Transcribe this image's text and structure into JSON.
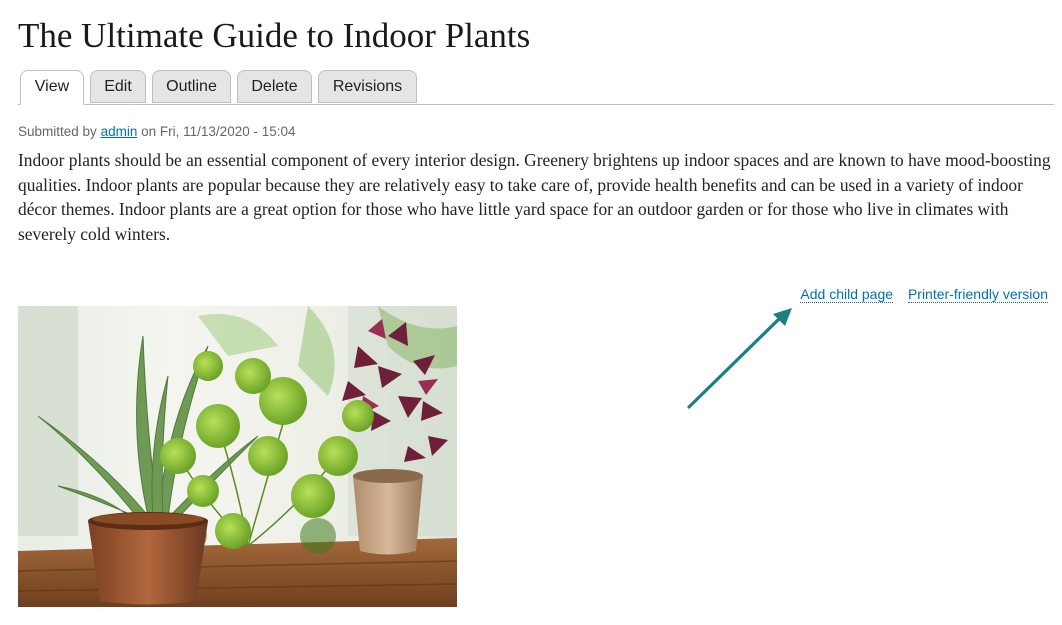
{
  "page": {
    "title": "The Ultimate Guide to Indoor Plants"
  },
  "tabs": [
    {
      "label": "View",
      "active": true
    },
    {
      "label": "Edit",
      "active": false
    },
    {
      "label": "Outline",
      "active": false
    },
    {
      "label": "Delete",
      "active": false
    },
    {
      "label": "Revisions",
      "active": false
    }
  ],
  "submitted": {
    "prefix": "Submitted by",
    "author": "admin",
    "middle": "on",
    "date": "Fri, 11/13/2020 - 15:04"
  },
  "body": {
    "paragraph": "Indoor plants should be an essential component of every interior design. Greenery brightens up indoor spaces and are known to have mood-boosting qualities. Indoor plants are popular because they are relatively easy to take care of, provide health benefits and can be used in a variety of indoor décor themes. Indoor plants are a great option for those who have little yard space for an outdoor garden or for those who live in climates with severely cold winters."
  },
  "book_links": {
    "add_child": "Add child page",
    "printer_friendly": "Printer-friendly version"
  },
  "colors": {
    "link": "#0071b3",
    "annotation_arrow": "#1a8080",
    "tab_inactive_bg": "#e5e5e5"
  },
  "icons": {
    "annotation": "arrow-pointer-icon"
  }
}
